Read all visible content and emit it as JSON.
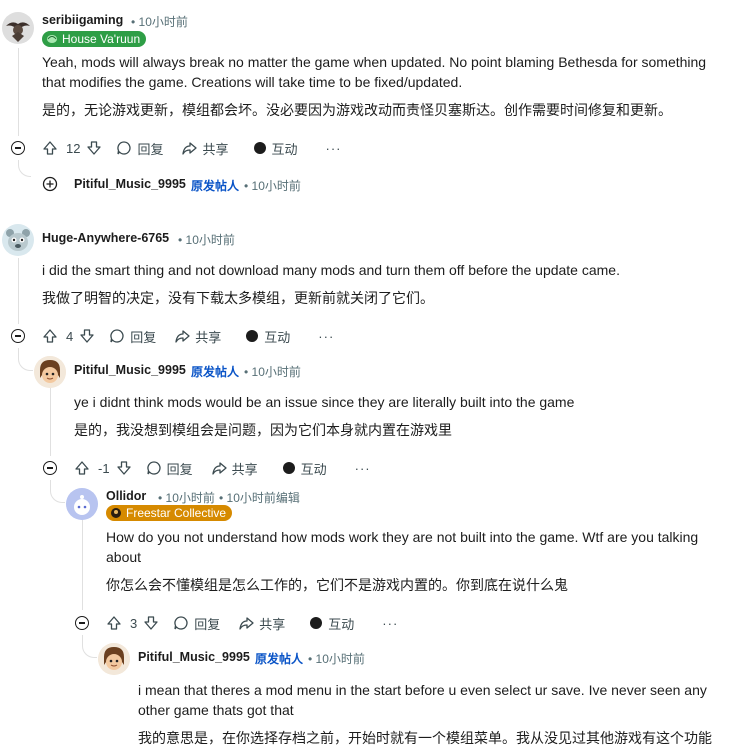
{
  "comments": [
    {
      "username": "seribiigaming",
      "time": "• 10小时前",
      "flair": "House Va'ruun",
      "flair_color": "#2e9e46",
      "text_en": "Yeah, mods will always break no matter the game when updated. No point blaming Bethesda for something that modifies the game. Creations will take time to be fixed/updated.",
      "text_zh": "是的，无论游戏更新，模组都会坏。没必要因为游戏改动而责怪贝塞斯达。创作需要时间修复和更新。",
      "votes": "12",
      "reply": "回复",
      "share": "共享",
      "award": "互动",
      "more": "···"
    },
    {
      "username": "Huge-Anywhere-6765",
      "time": "• 10小时前",
      "text_en": "i did the smart thing and not download many mods and turn them off before the update came.",
      "text_zh": "我做了明智的决定，没有下载太多模组，更新前就关闭了它们。",
      "votes": "4",
      "reply": "回复",
      "share": "共享",
      "award": "互动",
      "more": "···"
    },
    {
      "username": "Pitiful_Music_9995",
      "op_label": "原发帖人",
      "time": "• 10小时前",
      "text_en": "ye i didnt think mods would be an issue since they are literally built into the game",
      "text_zh": "是的，我没想到模组会是问题，因为它们本身就内置在游戏里",
      "votes": "-1",
      "reply": "回复",
      "share": "共享",
      "award": "互动",
      "more": "···"
    },
    {
      "username": "Ollidor",
      "time": "• 10小时前",
      "edited": "• 10小时前编辑",
      "flair": "Freestar Collective",
      "flair_color": "#d68a00",
      "text_en": "How do you not understand how mods work they are not built into the game. Wtf are you talking about",
      "text_zh": "你怎么会不懂模组是怎么工作的，它们不是游戏内置的。你到底在说什么鬼",
      "votes": "3",
      "reply": "回复",
      "share": "共享",
      "award": "互动",
      "more": "···"
    },
    {
      "username": "Pitiful_Music_9995",
      "op_label": "原发帖人",
      "time": "• 10小时前",
      "text_en": "i mean that theres a mod menu in the start before u even select ur save. Ive never seen any other game thats got that",
      "text_zh": "我的意思是，在你选择存档之前，开始时就有一个模组菜单。我从没见过其他游戏有这个功能"
    }
  ],
  "collapsed_reply": {
    "username": "Pitiful_Music_9995",
    "op_label": "原发帖人",
    "time": "• 10小时前"
  }
}
